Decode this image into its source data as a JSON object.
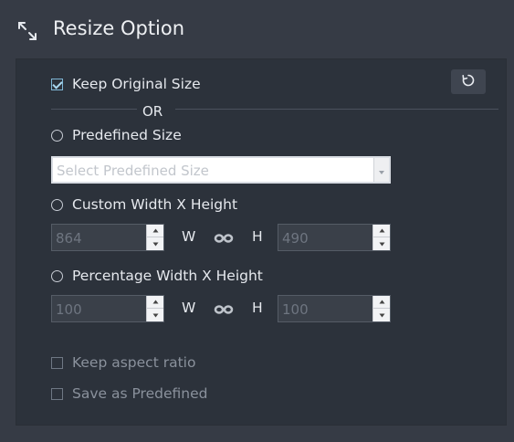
{
  "header": {
    "title": "Resize Option",
    "icon": "resize-arrows-icon"
  },
  "options": {
    "keep_original_label": "Keep Original Size",
    "keep_original_checked": true,
    "or_label": "OR",
    "predefined_label": "Predefined Size",
    "predefined_placeholder": "Select Predefined Size",
    "custom_label": "Custom Width X Height",
    "custom_width": "864",
    "custom_height": "490",
    "percentage_label": "Percentage Width X Height",
    "percent_width": "100",
    "percent_height": "100",
    "w_label": "W",
    "h_label": "H",
    "keep_aspect_label": "Keep aspect ratio",
    "save_predefined_label": "Save as Predefined"
  },
  "colors": {
    "background": "#363b45",
    "panel": "#2c323b",
    "accent_check": "#7fb7d6"
  }
}
